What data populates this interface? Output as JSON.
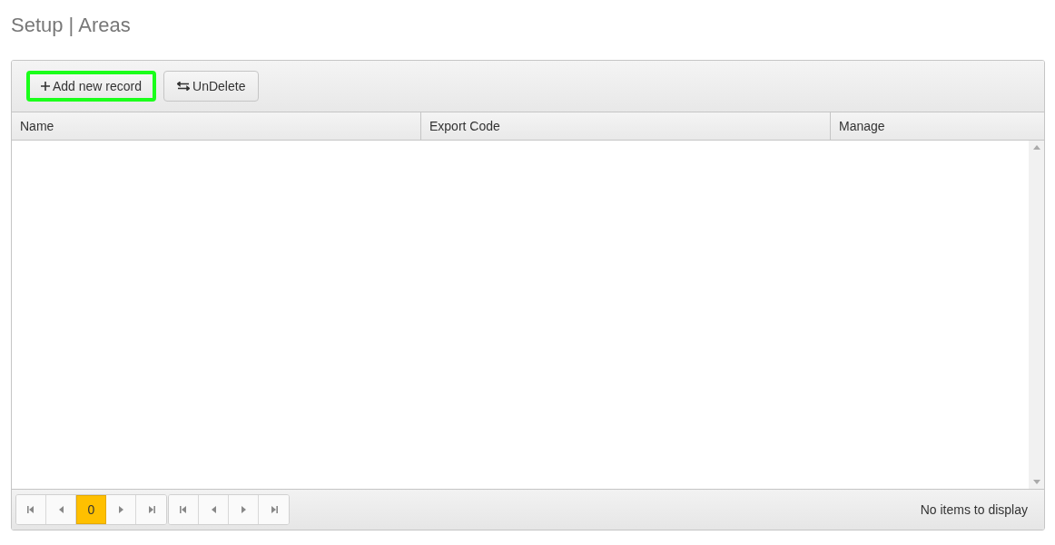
{
  "page_title": "Setup | Areas",
  "toolbar": {
    "buttons": [
      {
        "kind": "add",
        "label": "Add new record",
        "highlighted": true
      },
      {
        "kind": "undelete",
        "label": "UnDelete",
        "highlighted": false
      }
    ]
  },
  "table": {
    "columns": [
      "Name",
      "Export Code",
      "Manage"
    ]
  },
  "pager": {
    "groups": [
      [
        {
          "kind": "first"
        },
        {
          "kind": "prev"
        },
        {
          "kind": "page",
          "label": "0",
          "selected": true
        },
        {
          "kind": "next"
        },
        {
          "kind": "last"
        }
      ],
      [
        {
          "kind": "first"
        },
        {
          "kind": "prev"
        },
        {
          "kind": "next"
        },
        {
          "kind": "last"
        }
      ]
    ]
  },
  "status": "No items to display"
}
